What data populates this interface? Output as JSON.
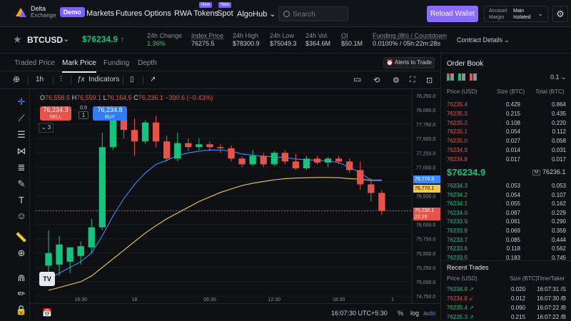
{
  "brand": {
    "name_line1": "Delta",
    "name_line2": "Exchange",
    "badge": "Demo"
  },
  "nav": {
    "markets": "Markets",
    "futures": "Futures",
    "options": "Options",
    "rwa_tokens": "RWA Tokens",
    "spot": "Spot",
    "algohub": "AlgoHub",
    "new_tag": "New"
  },
  "search": {
    "placeholder": "Search"
  },
  "header": {
    "reload_wallet": "Reload Wallet",
    "account_label": "Account",
    "account_value": "Main",
    "margin_label": "Margin",
    "margin_value": "Isolated"
  },
  "ticker": {
    "symbol": "BTCUSD",
    "last_price": "$76234.9 ↑",
    "stats": [
      {
        "label": "24h Change",
        "value": "1.36%"
      },
      {
        "label": "Index Price",
        "value": "76275.5"
      },
      {
        "label": "24h High",
        "value": "$78300.9"
      },
      {
        "label": "24h Low",
        "value": "$75049.3"
      },
      {
        "label": "24h Vol.",
        "value": "$364.6M"
      },
      {
        "label": "OI",
        "value": "$50.1M"
      },
      {
        "label": "Funding (8h) / Countdown",
        "value": "0.0100% / 05h:22m:28s"
      }
    ],
    "contract_details": "Contract Details ⌄"
  },
  "chart_tabs": [
    "Traded Price",
    "Mark Price",
    "Funding",
    "Depth"
  ],
  "chart_tabs_active": 1,
  "alerts_button": "Alerts to Trade",
  "toolbar": {
    "interval": "1h",
    "indicators": "Indicators"
  },
  "chart": {
    "ohlc": {
      "o": "76,558.5",
      "h": "76,559.1",
      "l": "76,164.5",
      "c": "76,236.1",
      "chg": "−330.6 (−0.43%)"
    },
    "sell_price": "76,234.3",
    "sell_label": "SELL",
    "buy_price": "76,234.8",
    "buy_label": "BUY",
    "spread": "0.5",
    "qty": "1",
    "collapse": "⌄ 3",
    "tv_logo": "TV",
    "tag_blue": "76,776.3",
    "tag_yellow": "76,770.1",
    "tag_red_price": "76,236.1",
    "tag_red_time": "22:29"
  },
  "chart_data": {
    "type": "candlestick",
    "ylim": [
      74750,
      78300
    ],
    "ytick_values": [
      78250,
      78000,
      77750,
      77500,
      77250,
      77000,
      76750,
      76500,
      76250,
      76000,
      75750,
      75500,
      75250,
      75000,
      74750
    ],
    "yticks": [
      "78,250.0",
      "78,000.0",
      "77,750.0",
      "77,500.0",
      "77,250.0",
      "77,000.0",
      "76,750.0",
      "76,500.0",
      "76,250.0",
      "76,000.0",
      "75,750.0",
      "75,500.0",
      "75,250.0",
      "75,000.0",
      "74,750.0"
    ],
    "xticks": [
      {
        "label": "18:30",
        "index": 3
      },
      {
        "label": "18",
        "index": 8
      },
      {
        "label": "06:30",
        "index": 15
      },
      {
        "label": "12:30",
        "index": 21
      },
      {
        "label": "18:30",
        "index": 27
      },
      {
        "label": "1",
        "index": 32
      }
    ],
    "candles": [
      {
        "o": 75280,
        "h": 75900,
        "l": 75000,
        "c": 75500
      },
      {
        "o": 75300,
        "h": 75800,
        "l": 75100,
        "c": 75650
      },
      {
        "o": 75350,
        "h": 75600,
        "l": 75150,
        "c": 75600
      },
      {
        "o": 75450,
        "h": 75700,
        "l": 75300,
        "c": 75620
      },
      {
        "o": 75600,
        "h": 76100,
        "l": 75500,
        "c": 75950
      },
      {
        "o": 75950,
        "h": 77600,
        "l": 75900,
        "c": 77350
      },
      {
        "o": 77350,
        "h": 78000,
        "l": 77300,
        "c": 77850
      },
      {
        "o": 77850,
        "h": 77950,
        "l": 77500,
        "c": 77650
      },
      {
        "o": 77650,
        "h": 77850,
        "l": 77200,
        "c": 77450
      },
      {
        "o": 77450,
        "h": 77820,
        "l": 77400,
        "c": 77780
      },
      {
        "o": 77780,
        "h": 77900,
        "l": 77350,
        "c": 77450
      },
      {
        "o": 77450,
        "h": 77550,
        "l": 77100,
        "c": 77150
      },
      {
        "o": 77150,
        "h": 77600,
        "l": 77100,
        "c": 77420
      },
      {
        "o": 77420,
        "h": 77500,
        "l": 77280,
        "c": 77350
      },
      {
        "o": 77350,
        "h": 77500,
        "l": 77300,
        "c": 77400
      },
      {
        "o": 77400,
        "h": 77450,
        "l": 77280,
        "c": 77350
      },
      {
        "o": 77350,
        "h": 77400,
        "l": 77250,
        "c": 77330
      },
      {
        "o": 77330,
        "h": 77380,
        "l": 77100,
        "c": 77150
      },
      {
        "o": 77150,
        "h": 77180,
        "l": 77000,
        "c": 77050
      },
      {
        "o": 77050,
        "h": 77300,
        "l": 77020,
        "c": 77200
      },
      {
        "o": 77200,
        "h": 77250,
        "l": 77000,
        "c": 77050
      },
      {
        "o": 77050,
        "h": 77280,
        "l": 77020,
        "c": 77250
      },
      {
        "o": 77250,
        "h": 77300,
        "l": 77050,
        "c": 77100
      },
      {
        "o": 77100,
        "h": 77230,
        "l": 76950,
        "c": 76980
      },
      {
        "o": 76980,
        "h": 77200,
        "l": 76950,
        "c": 77150
      },
      {
        "o": 77150,
        "h": 77200,
        "l": 77050,
        "c": 77080
      },
      {
        "o": 77080,
        "h": 77180,
        "l": 77000,
        "c": 77150
      },
      {
        "o": 77150,
        "h": 77200,
        "l": 77050,
        "c": 77100
      },
      {
        "o": 77100,
        "h": 77150,
        "l": 76900,
        "c": 76950
      },
      {
        "o": 76950,
        "h": 77100,
        "l": 76600,
        "c": 76700
      },
      {
        "o": 76700,
        "h": 76800,
        "l": 76400,
        "c": 76550
      },
      {
        "o": 76550,
        "h": 76600,
        "l": 76164.5,
        "c": 76236.1
      }
    ],
    "ma_fast": [
      75050,
      75150,
      75250,
      75350,
      75500,
      75800,
      76150,
      76450,
      76700,
      76900,
      77050,
      77120,
      77200,
      77250,
      77280,
      77300,
      77300,
      77280,
      77230,
      77210,
      77190,
      77180,
      77170,
      77140,
      77130,
      77120,
      77110,
      77080,
      77000,
      76900,
      76776.3,
      76776.3
    ],
    "ma_slow": [
      74850,
      74900,
      74950,
      75000,
      75100,
      75250,
      75400,
      75550,
      75700,
      75850,
      75980,
      76100,
      76200,
      76300,
      76400,
      76480,
      76560,
      76620,
      76680,
      76720,
      76750,
      76780,
      76800,
      76810,
      76815,
      76820,
      76820,
      76815,
      76800,
      76790,
      76770.1,
      76770.1
    ],
    "colors": {
      "up": "#17c27e",
      "down": "#e5534b",
      "ma_fast": "#3a8bff",
      "ma_slow": "#f2c94c",
      "grid": "#1b1d23"
    }
  },
  "footer": {
    "time": "16:07:30 UTC+5:30",
    "pct": "%",
    "log": "log",
    "auto": "auto"
  },
  "orderbook": {
    "title": "Order Book",
    "tick": "0.1 ⌄",
    "headers": [
      "Price (USD)",
      "Size (BTC)",
      "Total (BTC)"
    ],
    "asks": [
      {
        "p": "76235.4",
        "s": "0.429",
        "t": "0.864"
      },
      {
        "p": "76235.3",
        "s": "0.215",
        "t": "0.435"
      },
      {
        "p": "76235.2",
        "s": "0.108",
        "t": "0.220"
      },
      {
        "p": "76235.1",
        "s": "0.054",
        "t": "0.112"
      },
      {
        "p": "76235.0",
        "s": "0.027",
        "t": "0.058"
      },
      {
        "p": "76234.9",
        "s": "0.014",
        "t": "0.031"
      },
      {
        "p": "76234.8",
        "s": "0.017",
        "t": "0.017"
      }
    ],
    "mid": "$76234.9",
    "mark": "76236.1",
    "mark_badge": "M",
    "bids": [
      {
        "p": "76234.3",
        "s": "0.053",
        "t": "0.053"
      },
      {
        "p": "76234.2",
        "s": "0.054",
        "t": "0.107"
      },
      {
        "p": "76234.1",
        "s": "0.055",
        "t": "0.162"
      },
      {
        "p": "76234.0",
        "s": "0.067",
        "t": "0.229"
      },
      {
        "p": "76233.9",
        "s": "0.061",
        "t": "0.290"
      },
      {
        "p": "76233.8",
        "s": "0.069",
        "t": "0.359"
      },
      {
        "p": "76233.7",
        "s": "0.085",
        "t": "0.444"
      },
      {
        "p": "76233.6",
        "s": "0.118",
        "t": "0.562"
      },
      {
        "p": "76233.5",
        "s": "0.183",
        "t": "0.745"
      }
    ]
  },
  "recent_trades": {
    "title": "Recent Trades",
    "headers": [
      "Price (USD)",
      "Size (BTC)",
      "Time/Taker"
    ],
    "rows": [
      {
        "p": "76234.9 ↗",
        "s": "0.020",
        "t": "16:07:31 /S",
        "side": "up"
      },
      {
        "p": "76234.8 ↙",
        "s": "0.012",
        "t": "16:07:30 /B",
        "side": "down"
      },
      {
        "p": "76235.4 ↗",
        "s": "0.090",
        "t": "16:07:22 /B",
        "side": "up"
      },
      {
        "p": "76235.3 ↗",
        "s": "0.215",
        "t": "16:07:22 /B",
        "side": "up"
      }
    ]
  }
}
